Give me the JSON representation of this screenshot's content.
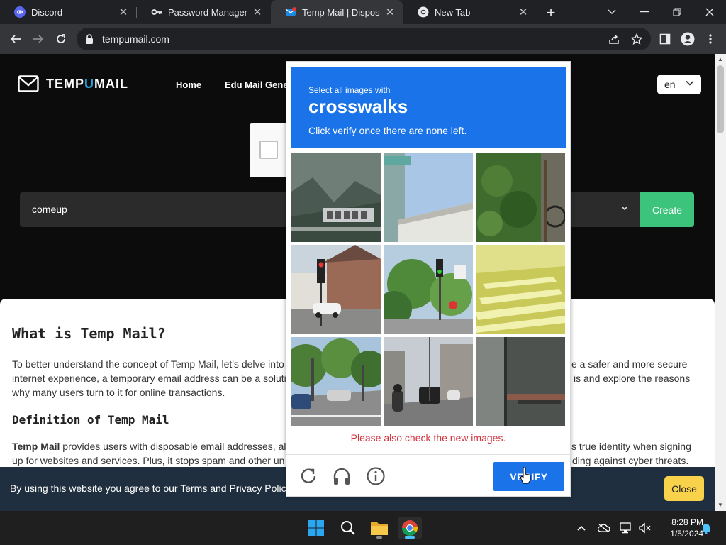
{
  "browser": {
    "tabs": [
      {
        "title": "Discord",
        "icon": "discord-icon",
        "active": false
      },
      {
        "title": "Password Manager",
        "icon": "key-icon",
        "active": false
      },
      {
        "title": "Temp Mail | Disposable",
        "icon": "tempmail-favicon",
        "active": true
      },
      {
        "title": "New Tab",
        "icon": "chrome-icon",
        "active": false
      }
    ],
    "url": "tempumail.com"
  },
  "site": {
    "logo": {
      "pre": "TEMP",
      "u": "U",
      "post": "MAIL"
    },
    "nav": {
      "home": "Home",
      "edu": "Edu Mail Genera"
    },
    "language": "en",
    "email_value": "comeup",
    "create_label": "Create",
    "heading": "What is Temp Mail?",
    "paragraph1_left": "To better understand the concept of Temp Mail, let's delve into",
    "paragraph1_right": "e a safer and more secure",
    "paragraph1_line2_left": "internet experience, a temporary email address can be a soluti",
    "paragraph1_line2_right": "is and explore the reasons",
    "paragraph1_line3": "why many users turn to it for online transactions.",
    "subheading": "Definition of Temp Mail",
    "p2_bold": "Temp Mail",
    "p2_line1_left": " provides users with disposable email addresses, all",
    "p2_line1_right": "s true identity when signing",
    "p2_line2_left": "up for websites and services. Plus, it stops spam and other un",
    "p2_line2_right": "ding against cyber threats.",
    "cookie_text": "By using this website you agree to our Terms and Privacy Policy",
    "cookie_close": "Close"
  },
  "captcha": {
    "prompt_line1": "Select all images with",
    "prompt_target": "crosswalks",
    "prompt_line3": "Click verify once there are none left.",
    "tiles": [
      {
        "label": "mountain-bridge-sign"
      },
      {
        "label": "building-roof-sky"
      },
      {
        "label": "green-hedge-bicycle"
      },
      {
        "label": "street-traffic-light-house"
      },
      {
        "label": "trees-traffic-light"
      },
      {
        "label": "crosswalk-yellow"
      },
      {
        "label": "road-trees-cars"
      },
      {
        "label": "street-motorcycle-traffic"
      },
      {
        "label": "truck-side"
      }
    ],
    "warning": "Please also check the new images.",
    "verify_label": "VERIFY"
  },
  "taskbar": {
    "time": "8:28 PM",
    "date": "1/5/2024"
  },
  "colors": {
    "accent_blue": "#1a73e8",
    "create_green": "#3cc47c",
    "close_yellow": "#f7d24a",
    "warning_red": "#d0343f"
  }
}
